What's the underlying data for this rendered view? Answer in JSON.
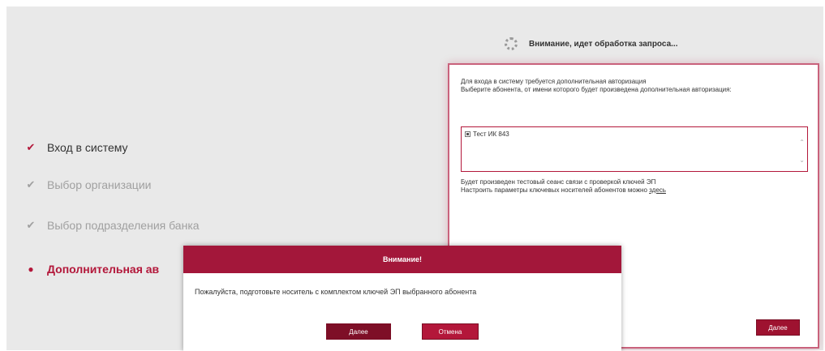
{
  "steps": [
    {
      "label": "Вход в систему",
      "state": "active",
      "icon": "check-icon"
    },
    {
      "label": "Выбор организации",
      "state": "done",
      "icon": "check-icon"
    },
    {
      "label": "Выбор подразделения банка",
      "state": "done",
      "icon": "check-icon"
    },
    {
      "label": "Дополнительная ав",
      "state": "current",
      "icon": "bullet-icon"
    }
  ],
  "processing": {
    "text": "Внимание, идет обработка запроса..."
  },
  "auth_panel": {
    "line1": "Для входа в систему требуется дополнительная авторизация",
    "line2": "Выберите абонента, от имени которого будет произведена дополнительная авторизация:",
    "subscriber": "Тест ИК 843",
    "info_line1": "Будет произведен тестовый сеанс связи с проверкой ключей ЭП",
    "info_line2": "Настроить параметры ключевых носителей абонентов можно",
    "info_link": "здесь",
    "next_button": "Далее"
  },
  "modal": {
    "title": "Внимание!",
    "message": "Пожалуйста, подготовьте носитель с комплектом ключей ЭП выбранного абонента",
    "next_button": "Далее",
    "cancel_button": "Отмена"
  },
  "colors": {
    "accent": "#b3173a",
    "modal_header": "#a3173a",
    "muted": "#a0a0a0"
  }
}
